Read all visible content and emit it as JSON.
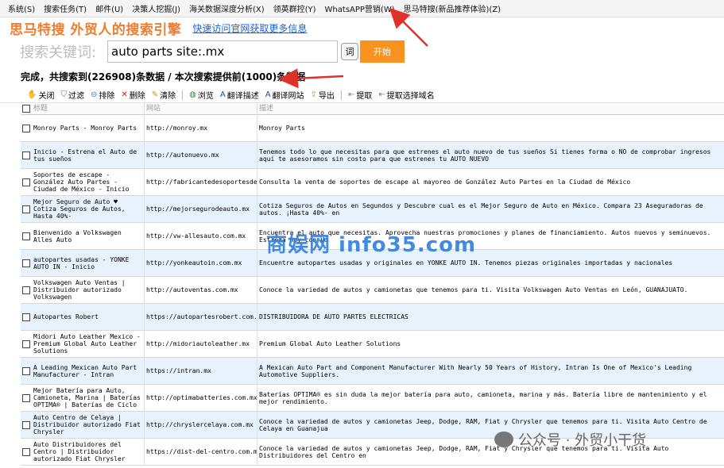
{
  "menu": [
    "系统(S)",
    "搜索任务(T)",
    "邮件(U)",
    "决策人挖掘(J)",
    "海关数据深度分析(X)",
    "领英群控(Y)",
    "WhatsAPP营销(W)",
    "思马特搜(新品推荐体验)(Z)"
  ],
  "brand": {
    "title": "思马特搜  外贸人的搜索引擎",
    "link": "快速访问官网获取更多信息"
  },
  "search": {
    "label": "搜索关键词:",
    "value": "auto parts site:.mx",
    "dict_label": "词",
    "start_label": "开始"
  },
  "status": "完成，共搜索到(226908)条数据 / 本次搜索提供前(1000)条数据",
  "toolbar": [
    {
      "icon": "close-icon",
      "glyph": "✋",
      "label": "关闭",
      "color": "#c8901a"
    },
    {
      "icon": "filter-icon",
      "glyph": "⛉",
      "label": "过滤",
      "color": "#3a7bd5"
    },
    {
      "icon": "exclude-icon",
      "glyph": "⊖",
      "label": "排除",
      "color": "#3a7bd5"
    },
    {
      "icon": "delete-icon",
      "glyph": "✕",
      "label": "删除",
      "color": "#d42020"
    },
    {
      "icon": "clear-icon",
      "glyph": "✎",
      "label": "清除",
      "color": "#d98a1a"
    },
    {
      "icon": "browse-icon",
      "glyph": "◍",
      "label": "浏览",
      "color": "#2a8a3a"
    },
    {
      "icon": "translate-desc-icon",
      "glyph": "A",
      "label": "翻译描述",
      "color": "#1a4fa0"
    },
    {
      "icon": "translate-site-icon",
      "glyph": "A",
      "label": "翻译网站",
      "color": "#1a4fa0"
    },
    {
      "icon": "export-icon",
      "glyph": "⇪",
      "label": "导出",
      "color": "#d98a1a"
    },
    {
      "icon": "extract-icon",
      "glyph": "⇤",
      "label": "提取",
      "color": "#7a8aa0"
    },
    {
      "icon": "extract-domain-icon",
      "glyph": "⇤",
      "label": "提取选择域名",
      "color": "#7a8aa0"
    }
  ],
  "columns": {
    "title": "标题",
    "url": "网站",
    "desc": "描述"
  },
  "rows": [
    {
      "title": "Monroy Parts - Monroy Parts",
      "url": "http://monroy.mx",
      "desc": "Monroy Parts"
    },
    {
      "title": "Inicio - Estrena el Auto de tus sueños",
      "url": "http://autonuevo.mx",
      "desc": "Tenemos todo lo que necesitas para que estrenes el auto nuevo de tus sueños Si tienes forma o NO de comprobar ingresos aquí te asesoramos sin costo para que estrenes tu AUTO NUEVO"
    },
    {
      "title": "Soportes de escape - González Auto Partes - Ciudad de México - Inicio",
      "url": "http://fabricantedesoportesdeescape.com.mx",
      "desc": "Consulta la venta de soportes de escape al mayoreo de González Auto Partes en la Ciudad de México"
    },
    {
      "title": "Mejor Seguro de Auto ♥ Cotiza Seguros de Autos, Hasta 40%-",
      "url": "http://mejorsegurodeauto.mx",
      "desc": "Cotiza Seguros de Autos en Segundos y Descubre cual es el Mejor Seguro de Auto en México. Compara 23 Aseguradoras de autos. ¡Hasta 40%- en"
    },
    {
      "title": "Bienvenido a Volkswagen Alles Auto",
      "url": "http://vw-allesauto.com.mx",
      "desc": "Encuentra el auto que necesitas. Aprovecha nuestras promociones y planes de financiamiento. Autos nuevos y seminuevos. Estrena hoy con Vo"
    },
    {
      "title": "autopartes usadas - YONKE AUTO IN - Inicio",
      "url": "http://yonkeautoin.com.mx",
      "desc": "Encuentre autopartes usadas y originales en YONKE AUTO IN. Tenemos piezas originales importadas y nacionales"
    },
    {
      "title": "Volkswagen Auto Ventas | Distribuidor autorizado Volkswagen",
      "url": "http://autoventas.com.mx",
      "desc": "Conoce la variedad de autos y camionetas que tenemos para ti. Visita Volkswagen Auto Ventas en León, GUANAJUATO."
    },
    {
      "title": "Autopartes Robert",
      "url": "https://autopartesrobert.com.mx",
      "desc": "DISTRIBUIDORA DE AUTO PARTES ELECTRICAS"
    },
    {
      "title": "Midori Auto Leather Mexico - Premium Global Auto Leather Solutions",
      "url": "http://midoriautoleather.mx",
      "desc": "Premium Global Auto Leather Solutions"
    },
    {
      "title": "A Leading Mexican Auto Part Manufacturer - Intran",
      "url": "https://intran.mx",
      "desc": "A Mexican Auto Part and Component Manufacturer With Nearly 50 Years of History, Intran Is One of Mexico's Leading Automotive Suppliers."
    },
    {
      "title": "Mejor Batería para Auto, Camioneta, Marina | Baterías OPTIMA® | Baterías de Ciclo",
      "url": "http://optimabatteries.com.mx",
      "desc": "Baterías OPTIMA® es sin duda la mejor batería para auto, camioneta, marina y más. Batería libre de mantenimiento y el mejor rendimiento."
    },
    {
      "title": "Auto Centro de Celaya | Distribuidor autorizado Fiat Chrysler",
      "url": "http://chryslercelaya.com.mx",
      "desc": "Conoce la variedad de autos y camionetas Jeep, Dodge, RAM, Fiat y Chrysler que tenemos para ti. Visita Auto Centro de Celaya en Guanajua"
    },
    {
      "title": "Auto Distribuidores del Centro | Distribuidor autorizado Fiat Chrysler",
      "url": "https://dist-del-centro.com.mx",
      "desc": "Conoce la variedad de autos y camionetas Jeep, Dodge, RAM, Fiat y Chrysler que tenemos para ti. Visita Auto Distribuidores del Centro en"
    }
  ],
  "watermark": "商娱网 info35.com",
  "wechat": "公众号 · 外贸小干货",
  "colors": {
    "brand": "#f07c2c",
    "start": "#f7931e",
    "link": "#1a62d6",
    "row_alt": "#e8f2fc",
    "arrow": "#e0302a"
  }
}
